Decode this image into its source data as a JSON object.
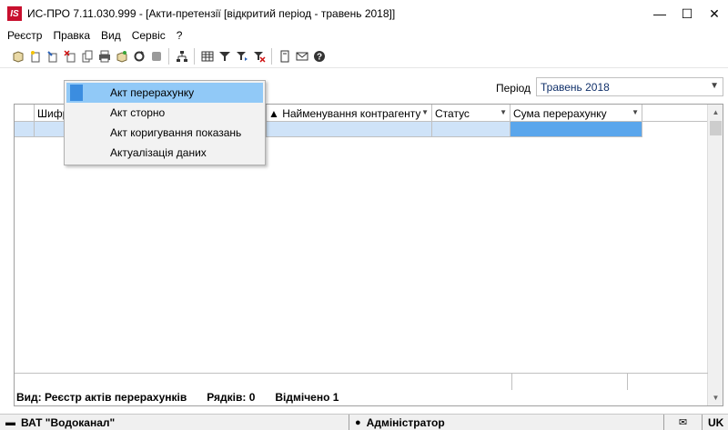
{
  "window": {
    "logo_text": "IS",
    "title": "ИС-ПРО 7.11.030.999 - [Акти-претензії [відкритий період - травень 2018]]",
    "buttons": {
      "minimize": "—",
      "maximize": "☐",
      "close": "✕"
    }
  },
  "menu": {
    "items": [
      "Реєстр",
      "Правка",
      "Вид",
      "Сервіс",
      "?"
    ]
  },
  "toolbar": {
    "icons": [
      "new-icon",
      "new-doc-icon",
      "edit-icon",
      "delete-icon",
      "copy-icon",
      "print-icon",
      "export-icon",
      "refresh-icon",
      "disabled-icon",
      "tree-icon",
      "grid-icon",
      "filter-icon",
      "filter-set-icon",
      "filter-clear-icon",
      "doc-icon",
      "mail-icon",
      "help-icon"
    ]
  },
  "period": {
    "label": "Період",
    "value": "Травень 2018"
  },
  "grid": {
    "columns": [
      "",
      "Шифр",
      "",
      "▲ Найменування контрагенту",
      "Статус",
      "Сума перерахунку"
    ]
  },
  "context_menu": {
    "items": [
      "Акт перерахунку",
      "Акт сторно",
      "Акт коригування показань",
      "Актуалізація даних"
    ]
  },
  "footer": {
    "view": "Вид: Реєстр актів перерахунків",
    "rows": "Рядків: 0",
    "marked": "Відмічено 1"
  },
  "statusbar": {
    "company": "ВАТ \"Водоканал\"",
    "user": "Адміністратор",
    "lang": "UK"
  }
}
